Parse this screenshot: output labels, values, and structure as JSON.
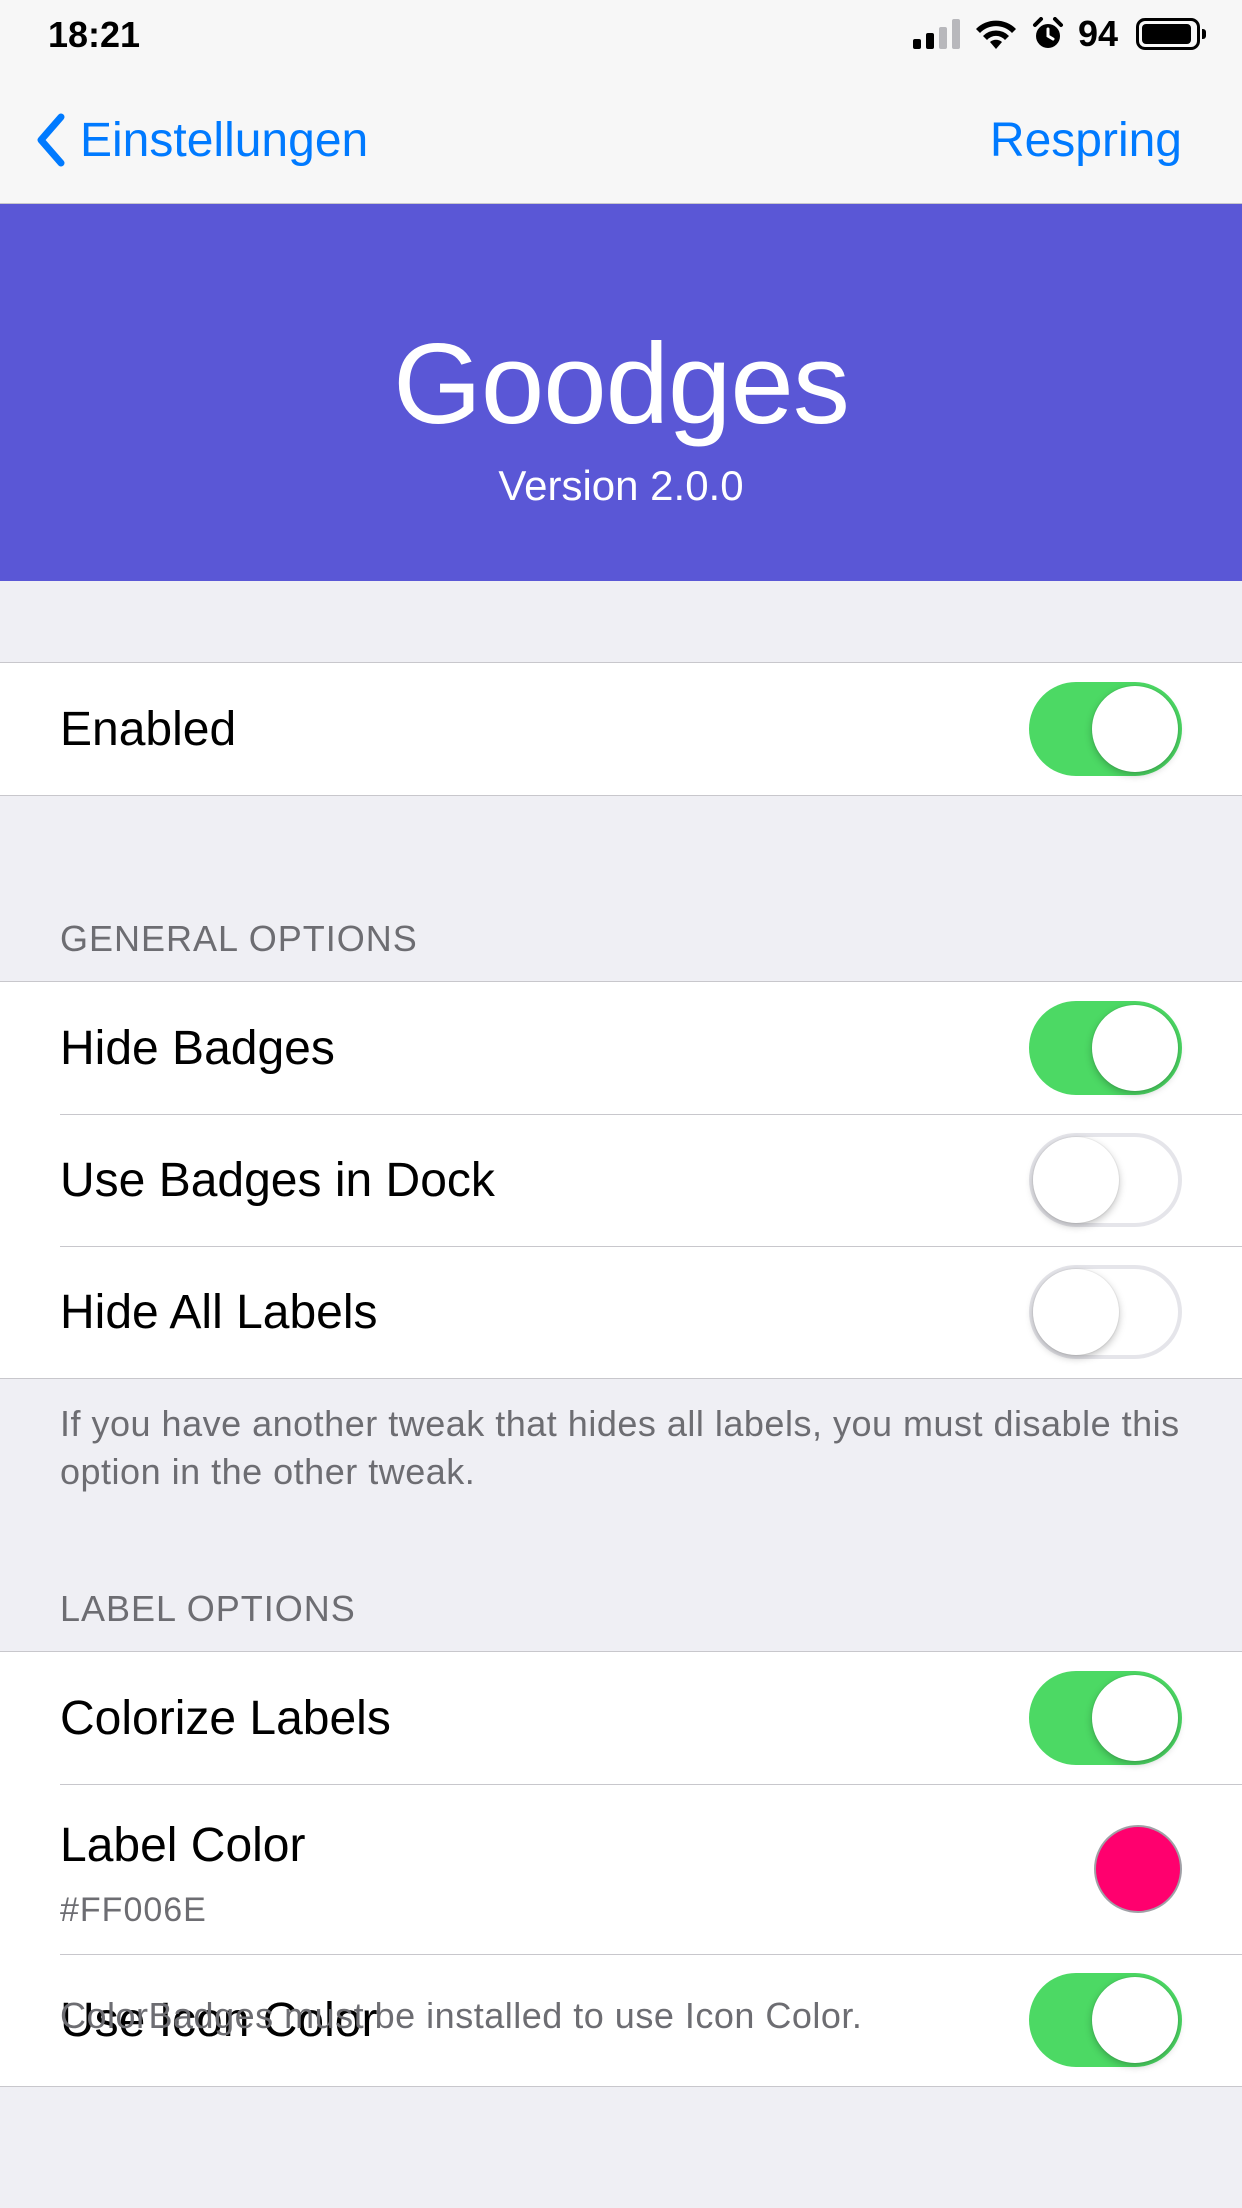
{
  "status_bar": {
    "time": "18:21",
    "battery_percent": "94",
    "battery_level": 0.94,
    "signal_bars_active": 2,
    "icons": [
      "signal-icon",
      "wifi-icon",
      "alarm-icon",
      "battery-icon"
    ]
  },
  "nav": {
    "back_label": "Einstellungen",
    "right_label": "Respring"
  },
  "header": {
    "title": "Goodges",
    "version": "Version 2.0.0",
    "color": "#5a57d6"
  },
  "enabled_group": {
    "enabled_label": "Enabled",
    "enabled_on": true
  },
  "general": {
    "header": "GENERAL OPTIONS",
    "hide_badges_label": "Hide Badges",
    "hide_badges_on": true,
    "use_badges_dock_label": "Use Badges in Dock",
    "use_badges_dock_on": false,
    "hide_all_labels_label": "Hide All Labels",
    "hide_all_labels_on": false,
    "footer": "If you have another tweak that hides all labels, you must disable this option in the other tweak."
  },
  "label": {
    "header": "LABEL OPTIONS",
    "colorize_labels_label": "Colorize Labels",
    "colorize_labels_on": true,
    "label_color_label": "Label Color",
    "label_color_value": "#FF006E",
    "label_color_swatch": "#ff006e",
    "use_icon_color_label": "Use Icon Color",
    "use_icon_color_on": true,
    "footer": "ColorBadges must be installed to use Icon Color."
  },
  "colors": {
    "accent": "#007aff",
    "toggle_on": "#4cd964",
    "secondary_text": "#6d6d72"
  }
}
